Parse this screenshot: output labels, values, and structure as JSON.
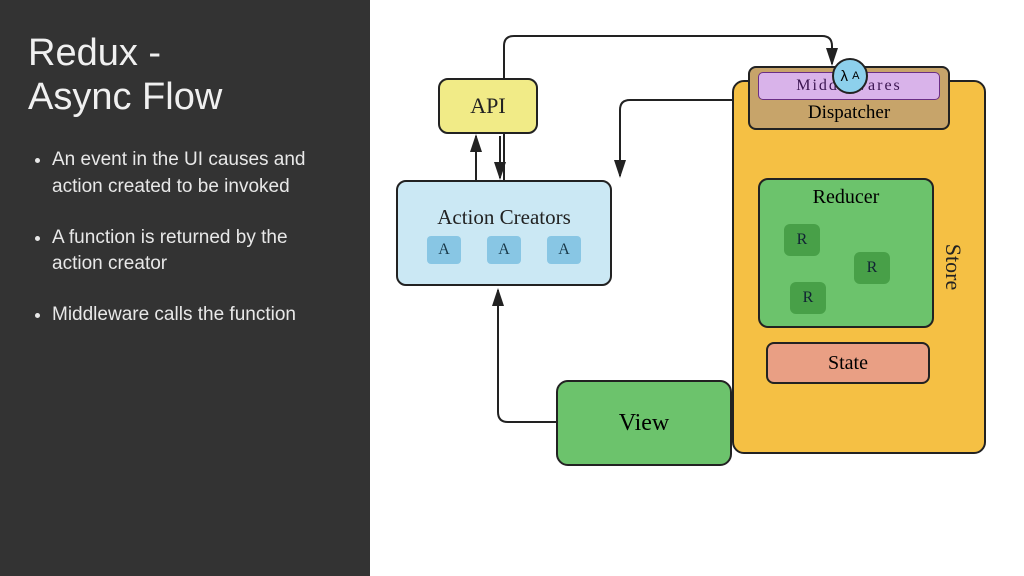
{
  "title": "Redux -\nAsync Flow",
  "bullets": [
    "An event in the UI causes and action created to be invoked",
    "A function is returned by the action creator",
    "Middleware calls the function"
  ],
  "nodes": {
    "api": "API",
    "action_creators": "Action Creators",
    "store": "Store",
    "dispatcher": "Dispatcher",
    "middlewares": "Middlewares",
    "reducer": "Reducer",
    "state": "State",
    "view": "View"
  },
  "badges": {
    "A": "A",
    "R": "R",
    "lambda": "λ"
  },
  "edges_comment": "Arrows: ActionCreators↔API (two-way), ActionCreators→Middlewares (top path), Middlewares→Dispatcher (implicit containment), Dispatcher→Reducer, Reducer→State (inside Store, with feedback loop to Reducer), State→View, View→ActionCreators. Moving action badge λ/A shown on the ActionCreators→Middlewares arrow near the middlewares box."
}
